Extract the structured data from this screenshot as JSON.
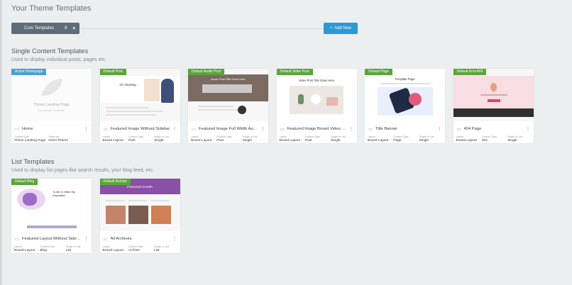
{
  "page": {
    "title": "Your Theme Templates"
  },
  "filter": {
    "select_label": "Core Templates",
    "select_count": "8",
    "add_new_label": "Add New"
  },
  "sections": {
    "single": {
      "title": "Single Content Templates",
      "subtitle": "Used to display individual posts, pages etc."
    },
    "list": {
      "title": "List Templates",
      "subtitle": "Used to display list pages like search results, your blog feed, etc."
    }
  },
  "meta_labels": {
    "layout": "Layout",
    "content_type": "Content Type",
    "single_or_list": "Single or List",
    "content_type_alt": "Content Type",
    "page_has": "Page has"
  },
  "cards_single": [
    {
      "badge": "Active Homepage",
      "badge_color": "blue",
      "name": "Home",
      "icon": "home-icon",
      "m1l": "Content Type",
      "m1v": "Thrive Landing Page",
      "m2l": "Page has",
      "m2v": "Omni Theme",
      "m3l": "",
      "m3v": "",
      "thumb_title": "Thrive Landing Page",
      "thumb_sub": "No preview available"
    },
    {
      "badge": "Default Post",
      "badge_color": "green",
      "name": "Featured Image Without Sidebar",
      "icon": "document-icon",
      "m1l": "Layout",
      "m1v": "Boxed Layout",
      "m2l": "Content Type",
      "m2v": "Post",
      "m3l": "Single or List",
      "m3v": "Single",
      "thumb_title": "On Starting"
    },
    {
      "badge": "Default Audio Post",
      "badge_color": "green",
      "name": "Featured Image Full Width Audi...",
      "icon": "audio-icon",
      "m1l": "Layout",
      "m1v": "Boxed Layout",
      "m2l": "Content Type",
      "m2v": "Post",
      "m3l": "Single or List",
      "m3v": "Single",
      "thumb_title": "Audio Post Title Goes Here"
    },
    {
      "badge": "Default Video Post",
      "badge_color": "green",
      "name": "Featured Image Boxed Video Po...",
      "icon": "video-icon",
      "m1l": "Layout",
      "m1v": "Boxed Layout",
      "m2l": "Content Type",
      "m2v": "Post",
      "m3l": "Single or List",
      "m3v": "Single",
      "thumb_title": "Video Post Title Goes Here"
    },
    {
      "badge": "Default Page",
      "badge_color": "green",
      "name": "Title Banner",
      "icon": "page-icon",
      "m1l": "Layout",
      "m1v": "Boxed Layout",
      "m2l": "Content Type",
      "m2v": "Page",
      "m3l": "Single or List",
      "m3v": "Single",
      "thumb_title": "Template Page"
    },
    {
      "badge": "Default Error404",
      "badge_color": "green",
      "name": "404 Page",
      "icon": "error-icon",
      "m1l": "Layout",
      "m1v": "Boxed Layout",
      "m2l": "Content Type",
      "m2v": "404",
      "m3l": "Single or List",
      "m3v": "Single",
      "thumb_title": ""
    }
  ],
  "cards_list": [
    {
      "badge": "Default Blog",
      "badge_color": "green",
      "name": "Featured Layout Without Sidebar",
      "icon": "list-icon",
      "m1l": "Layout",
      "m1v": "Boxed Layout",
      "m2l": "Content Type",
      "m2v": "Blog",
      "m3l": "Single or List",
      "m3v": "List",
      "thumb_title": "To Be Is Often My Inspiration"
    },
    {
      "badge": "Default Archive",
      "badge_color": "green",
      "name": "All Archives",
      "icon": "list-icon",
      "m1l": "Layout",
      "m1v": "Boxed Layout",
      "m2l": "Content Type",
      "m2v": "Archive",
      "m3l": "Single or List",
      "m3v": "List",
      "thumb_title": "Personal Growth"
    }
  ],
  "colors": {
    "accent": "#2d98d4",
    "badge_green": "#5ba53a",
    "badge_blue": "#4a9fd6",
    "select_bg": "#5d6c78"
  }
}
